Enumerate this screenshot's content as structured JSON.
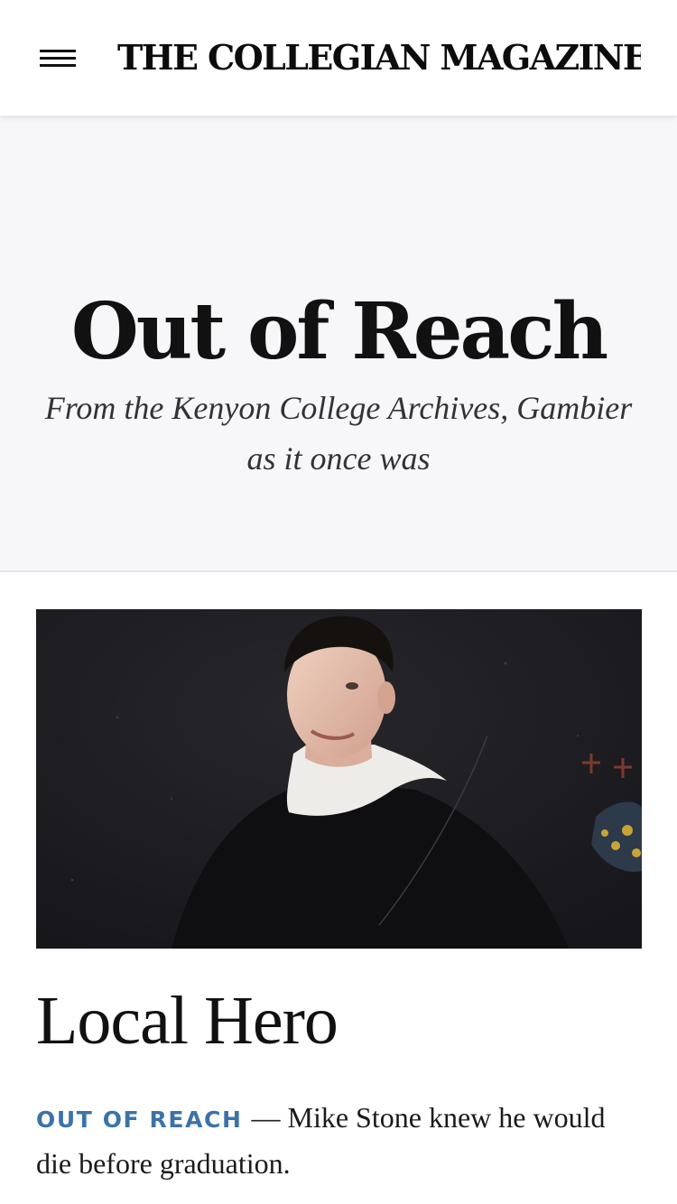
{
  "header": {
    "menu_icon": "hamburger-menu-icon",
    "site_title": "THE COLLEGIAN MAGAZINE"
  },
  "series": {
    "title": "Out of Reach",
    "subtitle": "From the Kenyon College Archives, Gambier as it once was"
  },
  "article": {
    "image_alt": "Archival photo of a young man in a dark choir robe with a white collar",
    "headline": "Local Hero",
    "category": "OUT OF REACH",
    "separator": "—",
    "dek": "Mike Stone knew he would die before graduation."
  },
  "colors": {
    "accent": "#3b73a8",
    "banner_bg": "#f7f7f9",
    "text": "#111111"
  }
}
